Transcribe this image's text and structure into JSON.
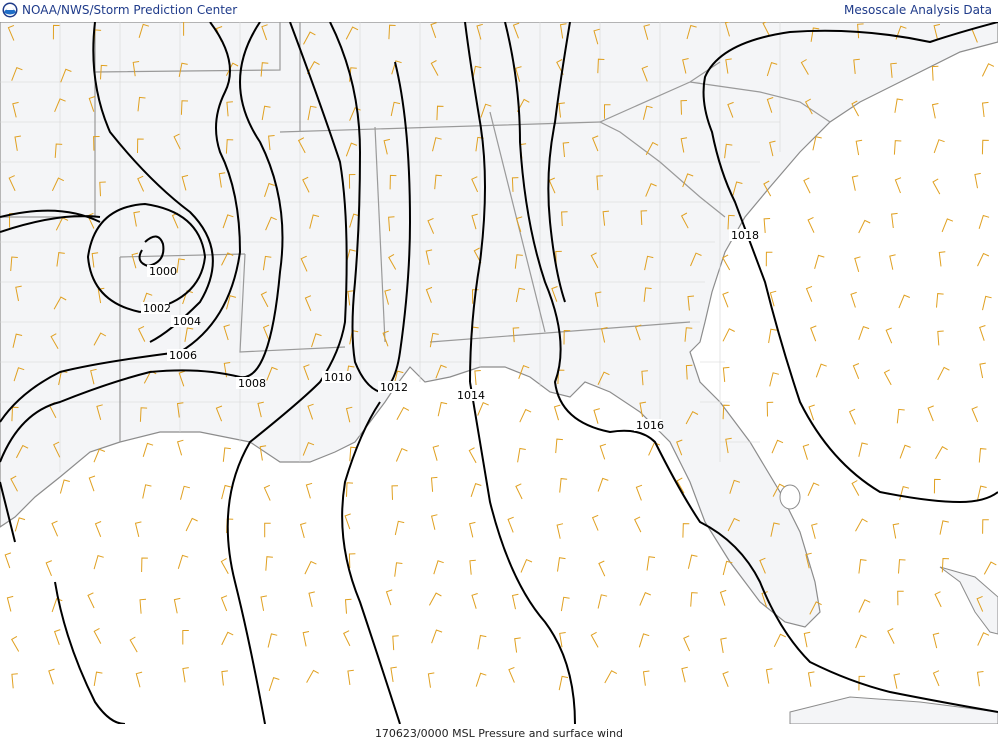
{
  "header": {
    "left_title": "NOAA/NWS/Storm Prediction Center",
    "right_title": "Mesoscale Analysis Data"
  },
  "footer": {
    "caption": "170623/0000 MSL Pressure and surface wind"
  },
  "isobar_labels": [
    "1000",
    "1002",
    "1004",
    "1006",
    "1008",
    "1010",
    "1012",
    "1014",
    "1016",
    "1018"
  ],
  "icons": {
    "logo": "noaa-logo-icon"
  },
  "colors": {
    "isobar": "#000000",
    "wind_barb": "#e0a020",
    "state_border": "#9a9a9a",
    "county_border": "#d0d0d0",
    "land": "#f4f5f7",
    "water": "#ffffff",
    "coast": "#888888"
  }
}
